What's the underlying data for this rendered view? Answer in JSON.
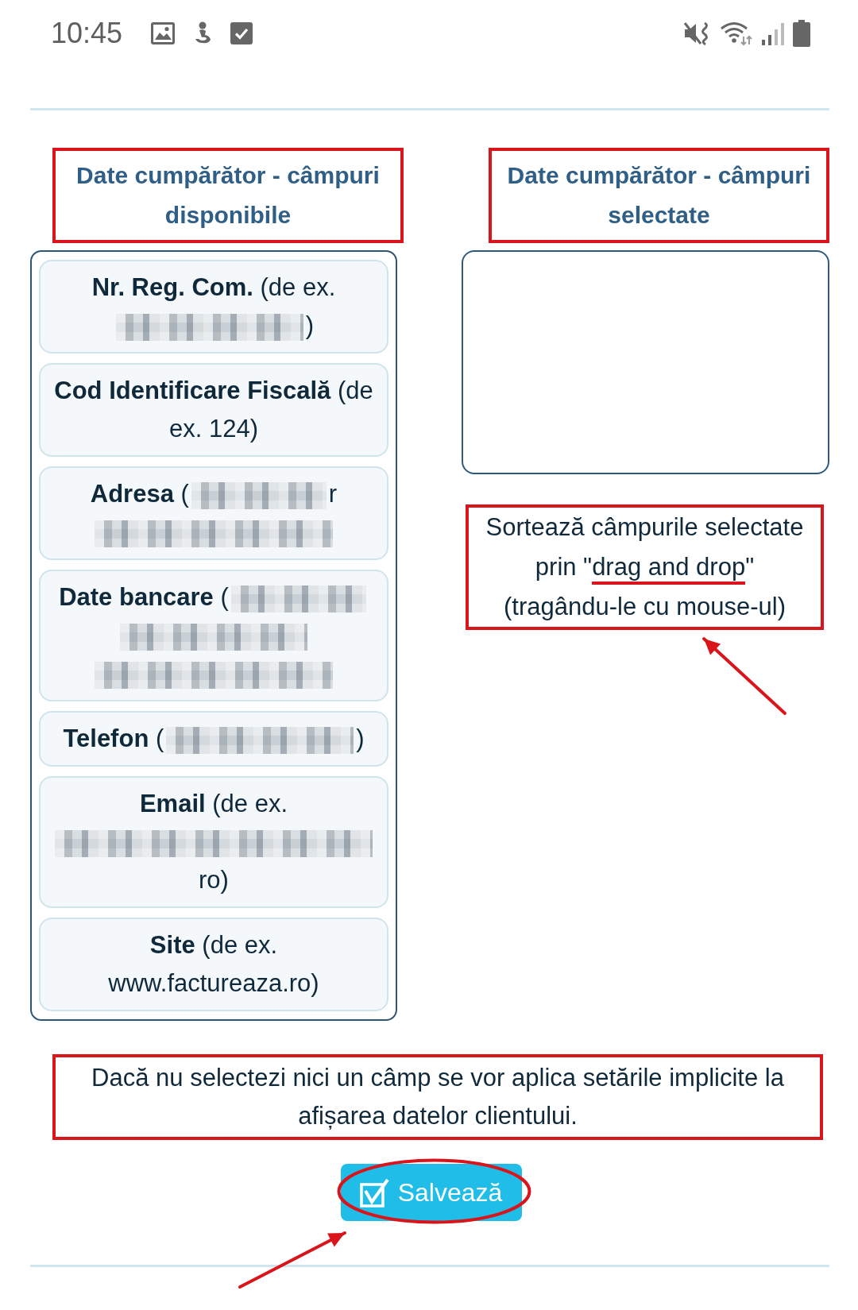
{
  "status_bar": {
    "time": "10:45"
  },
  "available_fields": {
    "heading": {
      "text": "Date cumpărător - câmpuri disponibile",
      "highlighted": true
    },
    "items": [
      {
        "label": "Nr. Reg. Com.",
        "example": [
          {
            "kind": "text",
            "text": "(de ex."
          },
          {
            "kind": "blur-medium"
          },
          {
            "kind": "text",
            "text": ")"
          }
        ]
      },
      {
        "label": "Cod Identificare Fiscală",
        "example": [
          {
            "kind": "text",
            "text": "(de ex. 124)"
          }
        ]
      },
      {
        "label": "Adresa",
        "example": [
          {
            "kind": "text",
            "text": "("
          },
          {
            "kind": "blur-short"
          },
          {
            "kind": "text",
            "text": "r"
          },
          {
            "kind": "blur-long"
          }
        ]
      },
      {
        "label": "Date bancare",
        "example": [
          {
            "kind": "text",
            "text": "("
          },
          {
            "kind": "blur-short"
          },
          {
            "kind": "blur-medium"
          },
          {
            "kind": "blur-long"
          }
        ]
      },
      {
        "label": "Telefon",
        "example": [
          {
            "kind": "text",
            "text": "("
          },
          {
            "kind": "blur-medium"
          },
          {
            "kind": "text",
            "text": ")"
          }
        ]
      },
      {
        "label": "Email",
        "example": [
          {
            "kind": "text",
            "text": "(de ex."
          },
          {
            "kind": "blur-wide"
          },
          {
            "kind": "text",
            "text": "ro)"
          }
        ]
      },
      {
        "label": "Site",
        "example": [
          {
            "kind": "text",
            "text": "(de ex. www.factureaza.ro)"
          }
        ]
      }
    ]
  },
  "selected_fields": {
    "heading": {
      "text": "Date cumpărător - câmpuri selectate",
      "highlighted": true
    },
    "sort_note": {
      "text_before": "Sortează câmpurile selectate prin \"",
      "underlined": "drag and drop",
      "text_after": "\" (tragându-le cu mouse-ul)",
      "highlighted": true
    }
  },
  "hint": {
    "text": "Dacă nu selectezi nici un câmp se vor aplica setările implicite la afișarea datelor clientului.",
    "highlighted": true
  },
  "save_button": {
    "label": "Salvează",
    "highlighted": true
  }
}
